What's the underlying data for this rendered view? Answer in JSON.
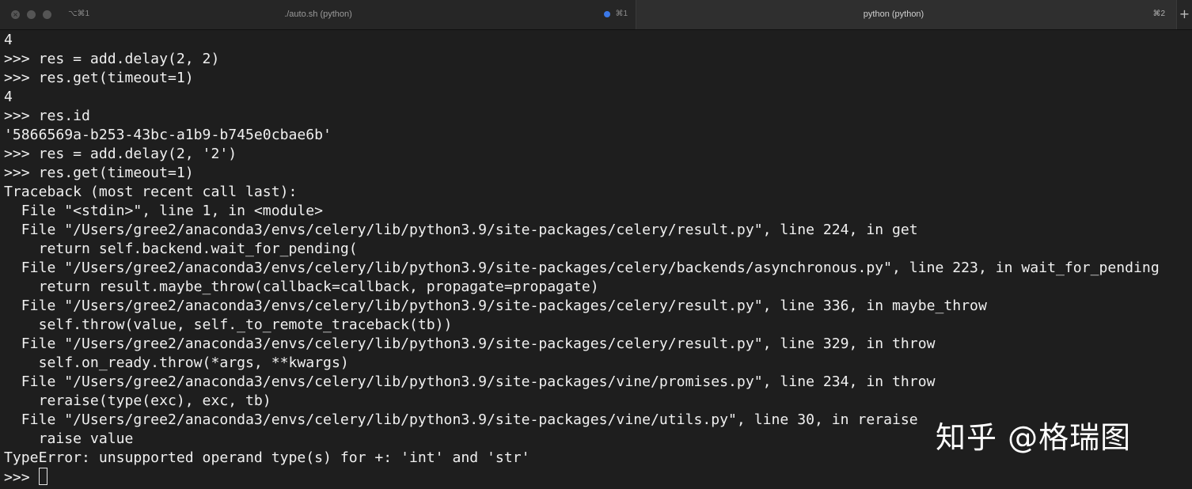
{
  "tabs": [
    {
      "shortcut_left": "⌥⌘1",
      "title": "./auto.sh (python)",
      "shortcut_right": "⌘1",
      "has_activity_dot": true,
      "active": false
    },
    {
      "title": "python (python)",
      "shortcut_right": "⌘2",
      "active": true
    }
  ],
  "new_tab_label": "+",
  "terminal": {
    "lines": [
      "4",
      ">>> res = add.delay(2, 2)",
      ">>> res.get(timeout=1)",
      "4",
      ">>> res.id",
      "'5866569a-b253-43bc-a1b9-b745e0cbae6b'",
      ">>> res = add.delay(2, '2')",
      ">>> res.get(timeout=1)",
      "Traceback (most recent call last):",
      "  File \"<stdin>\", line 1, in <module>",
      "  File \"/Users/gree2/anaconda3/envs/celery/lib/python3.9/site-packages/celery/result.py\", line 224, in get",
      "    return self.backend.wait_for_pending(",
      "  File \"/Users/gree2/anaconda3/envs/celery/lib/python3.9/site-packages/celery/backends/asynchronous.py\", line 223, in wait_for_pending",
      "    return result.maybe_throw(callback=callback, propagate=propagate)",
      "  File \"/Users/gree2/anaconda3/envs/celery/lib/python3.9/site-packages/celery/result.py\", line 336, in maybe_throw",
      "    self.throw(value, self._to_remote_traceback(tb))",
      "  File \"/Users/gree2/anaconda3/envs/celery/lib/python3.9/site-packages/celery/result.py\", line 329, in throw",
      "    self.on_ready.throw(*args, **kwargs)",
      "  File \"/Users/gree2/anaconda3/envs/celery/lib/python3.9/site-packages/vine/promises.py\", line 234, in throw",
      "    reraise(type(exc), exc, tb)",
      "  File \"/Users/gree2/anaconda3/envs/celery/lib/python3.9/site-packages/vine/utils.py\", line 30, in reraise",
      "    raise value",
      "TypeError: unsupported operand type(s) for +: 'int' and 'str'"
    ],
    "prompt": ">>> "
  },
  "watermark": "知乎 @格瑞图",
  "colors": {
    "background": "#1e1e1e",
    "text": "#f0f0f0",
    "tab_bar": "#2a2a2a",
    "activity_dot": "#3b78e7"
  }
}
